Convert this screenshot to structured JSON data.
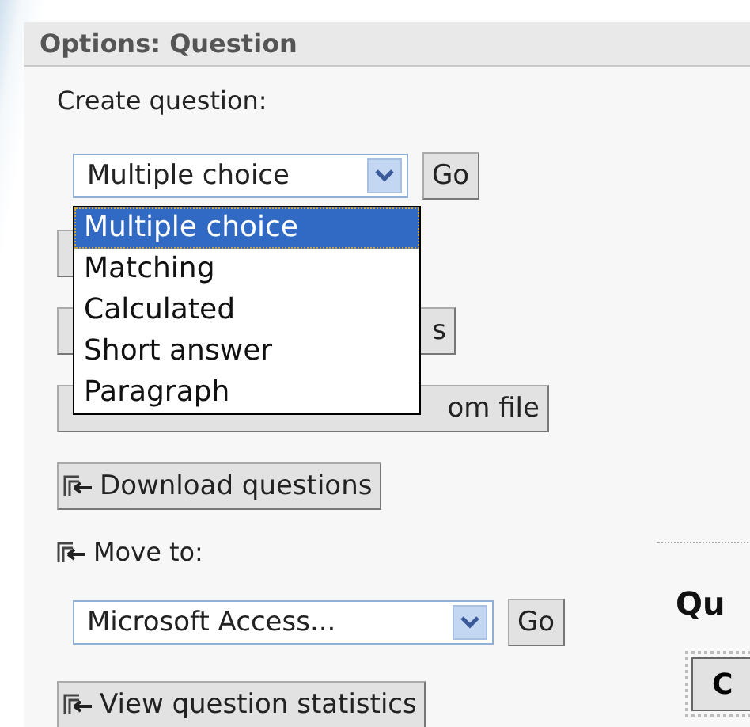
{
  "panel": {
    "title": "Options: Question",
    "create_label": "Create question:",
    "type_select": {
      "value": "Multiple choice",
      "expanded": true,
      "options": [
        {
          "label": "Multiple choice",
          "selected": true
        },
        {
          "label": "Matching",
          "selected": false
        },
        {
          "label": "Calculated",
          "selected": false
        },
        {
          "label": "Short answer",
          "selected": false
        },
        {
          "label": "Paragraph",
          "selected": false
        }
      ]
    },
    "go_button": "Go",
    "covered_buttons": [
      {
        "label": "s"
      },
      {
        "label": "om file"
      }
    ],
    "download_button": "Download questions",
    "move_label": "Move to:",
    "move_select": {
      "value": "Microsoft Access..."
    },
    "move_go_button": "Go",
    "stats_button": "View question statistics"
  },
  "side_panel": {
    "heading": "Qu",
    "button": "C"
  }
}
